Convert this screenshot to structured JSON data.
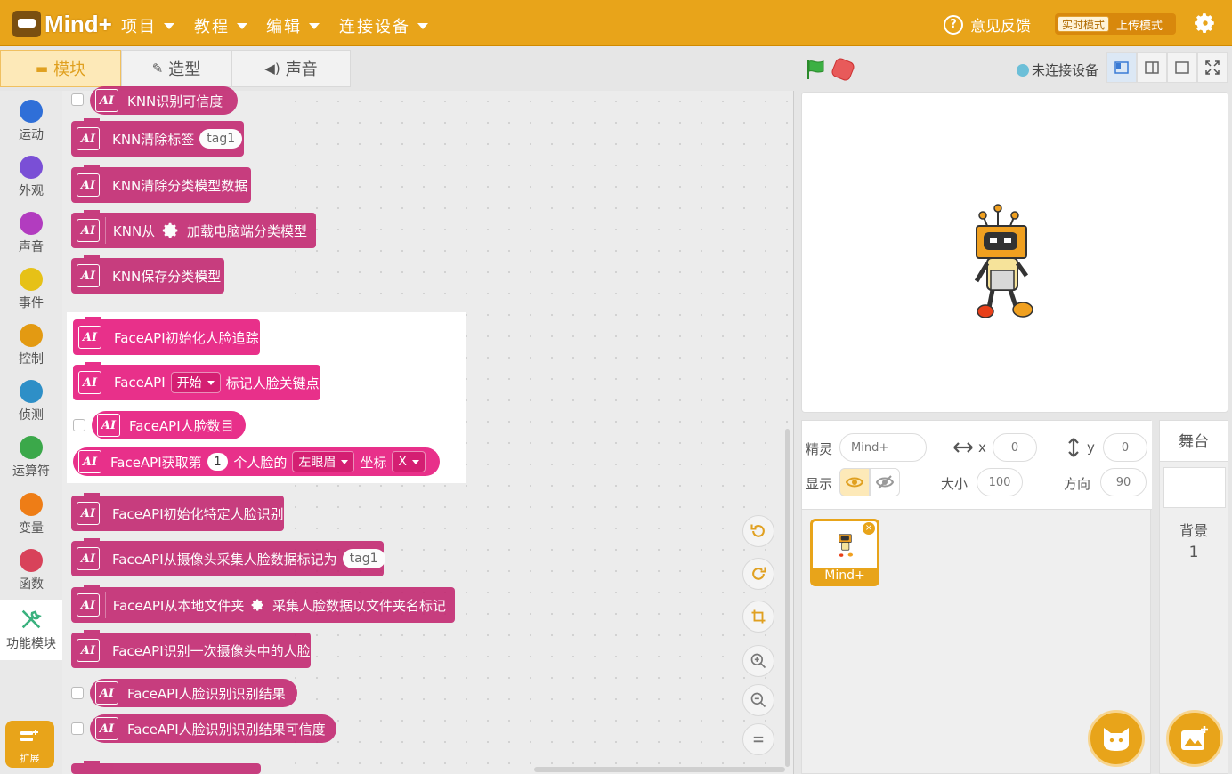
{
  "topbar": {
    "logo_text": "Mind+",
    "menus": [
      "项目",
      "教程",
      "编辑",
      "连接设备"
    ],
    "feedback": "意见反馈",
    "mode_realtime": "实时模式",
    "mode_upload": "上传模式"
  },
  "tabs": {
    "blocks": "模块",
    "costumes": "造型",
    "sounds": "声音"
  },
  "stage_bar": {
    "connection": "未连接设备"
  },
  "categories": [
    {
      "label": "运动",
      "color": "#2f6fd8"
    },
    {
      "label": "外观",
      "color": "#7a4fd6"
    },
    {
      "label": "声音",
      "color": "#b23cbf"
    },
    {
      "label": "事件",
      "color": "#e6c117"
    },
    {
      "label": "控制",
      "color": "#e39a12"
    },
    {
      "label": "侦测",
      "color": "#2e8fc7"
    },
    {
      "label": "运算符",
      "color": "#3ba84a"
    },
    {
      "label": "变量",
      "color": "#ee7d16"
    },
    {
      "label": "函数",
      "color": "#d8425a"
    },
    {
      "label": "功能模块",
      "color": "#3ab17e"
    }
  ],
  "extension_label": "扩展",
  "blocks": {
    "knn_confidence": "KNN识别可信度",
    "knn_clear_label": "KNN清除标签",
    "knn_clear_tag": "tag1",
    "knn_clear_all": "KNN清除分类模型数据",
    "knn_from": "KNN从",
    "knn_load": "加载电脑端分类模型",
    "knn_save": "KNN保存分类模型",
    "face_init": "FaceAPI初始化人脸追踪",
    "face_mark_a": "FaceAPI",
    "face_mark_dd": "开始",
    "face_mark_b": "标记人脸关键点",
    "face_count": "FaceAPI人脸数目",
    "face_get_a": "FaceAPI获取第",
    "face_get_num": "1",
    "face_get_b": "个人脸的",
    "face_get_dd1": "左眼眉",
    "face_get_c": "坐标",
    "face_get_dd2": "X",
    "face_init_specific": "FaceAPI初始化特定人脸识别",
    "face_collect_cam": "FaceAPI从摄像头采集人脸数据标记为",
    "face_collect_tag": "tag1",
    "face_local_a": "FaceAPI从本地文件夹",
    "face_local_b": "采集人脸数据以文件夹名标记",
    "face_recognize_once": "FaceAPI识别一次摄像头中的人脸",
    "face_result": "FaceAPI人脸识别识别结果",
    "face_result_conf": "FaceAPI人脸识别识别结果可信度",
    "ai_glyph": "AI"
  },
  "sprite": {
    "label_sprite": "精灵",
    "name": "Mind+",
    "label_x": "x",
    "x": "0",
    "label_y": "y",
    "y": "0",
    "label_show": "显示",
    "label_size": "大小",
    "size": "100",
    "label_direction": "方向",
    "direction": "90",
    "thumb_label": "Mind+"
  },
  "stage_panel": {
    "title": "舞台",
    "backdrop_label": "背景",
    "backdrop_count": "1"
  },
  "colors": {
    "brand": "#e8a41a",
    "ai_block": "#c2266f",
    "ai_block_bright": "#e8308a"
  }
}
